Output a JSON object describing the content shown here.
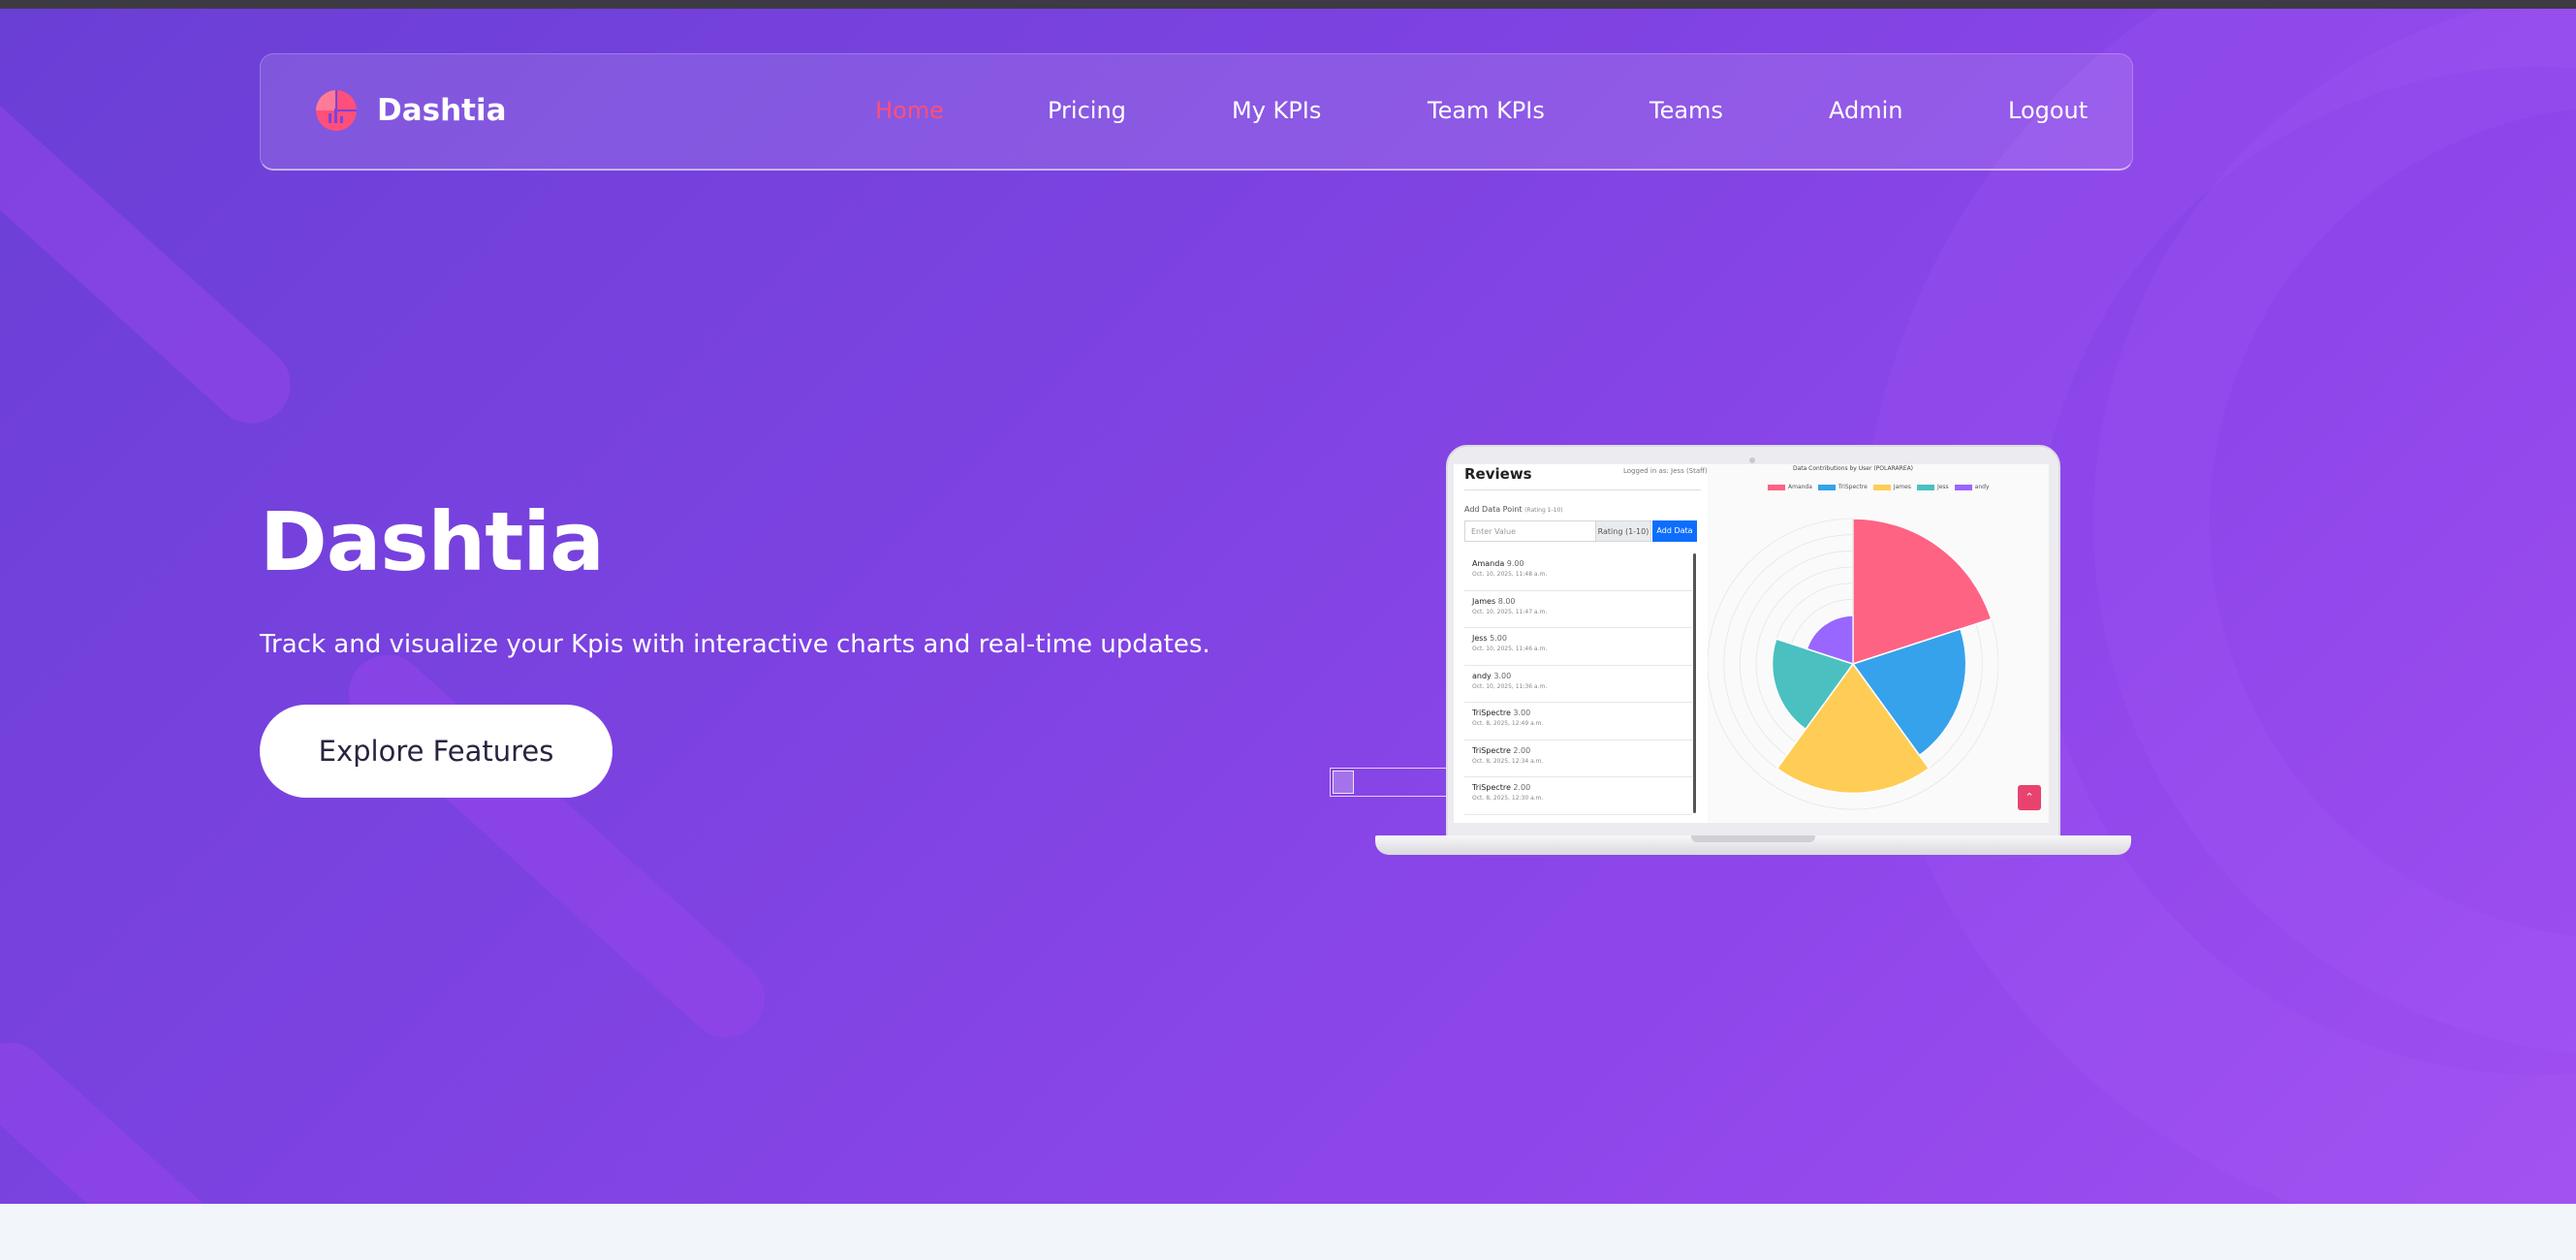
{
  "brand": {
    "name": "Dashtia",
    "icon": "pie-chart-logo-icon",
    "accent": "#ff4f7a"
  },
  "nav": {
    "items": [
      {
        "label": "Home",
        "active": true
      },
      {
        "label": "Pricing",
        "active": false
      },
      {
        "label": "My KPIs",
        "active": false
      },
      {
        "label": "Team KPIs",
        "active": false
      },
      {
        "label": "Teams",
        "active": false
      },
      {
        "label": "Admin",
        "active": false
      },
      {
        "label": "Logout",
        "active": false
      }
    ]
  },
  "hero": {
    "title": "Dashtia",
    "subtitle": "Track and visualize your Kpis with interactive charts and real-time updates.",
    "cta_label": "Explore Features",
    "gradient": [
      "#6a3fd6",
      "#a04ff0"
    ]
  },
  "screenshot": {
    "title": "Reviews",
    "logged_in": "Logged in as: Jess (Staff)",
    "add_label": "Add Data Point",
    "add_hint": "(Rating 1-10)",
    "input_placeholder": "Enter Value",
    "rating_label": "Rating (1-10)",
    "add_button": "Add Data",
    "entries": [
      {
        "name": "Amanda",
        "value": "9.00",
        "date": "Oct. 10, 2025, 11:48 a.m."
      },
      {
        "name": "James",
        "value": "8.00",
        "date": "Oct. 10, 2025, 11:47 a.m."
      },
      {
        "name": "Jess",
        "value": "5.00",
        "date": "Oct. 10, 2025, 11:46 a.m."
      },
      {
        "name": "andy",
        "value": "3.00",
        "date": "Oct. 10, 2025, 11:36 a.m."
      },
      {
        "name": "TriSpectre",
        "value": "3.00",
        "date": "Oct. 8, 2025, 12:49 a.m."
      },
      {
        "name": "TriSpectre",
        "value": "2.00",
        "date": "Oct. 8, 2025, 12:34 a.m."
      },
      {
        "name": "TriSpectre",
        "value": "2.00",
        "date": "Oct. 8, 2025, 12:30 a.m."
      }
    ],
    "scroll_top_icon": "chevron-up-icon"
  },
  "chart_data": {
    "type": "polarArea",
    "title": "Data Contributions by User (POLARAREA)",
    "categories": [
      "Amanda",
      "TriSpectre",
      "James",
      "Jess",
      "andy"
    ],
    "values": [
      9,
      7,
      8,
      5,
      3
    ],
    "colors": [
      "#ff6384",
      "#36a2eb",
      "#ffcd56",
      "#4bc0c0",
      "#9966ff"
    ],
    "legend_position": "top",
    "grid": true
  }
}
